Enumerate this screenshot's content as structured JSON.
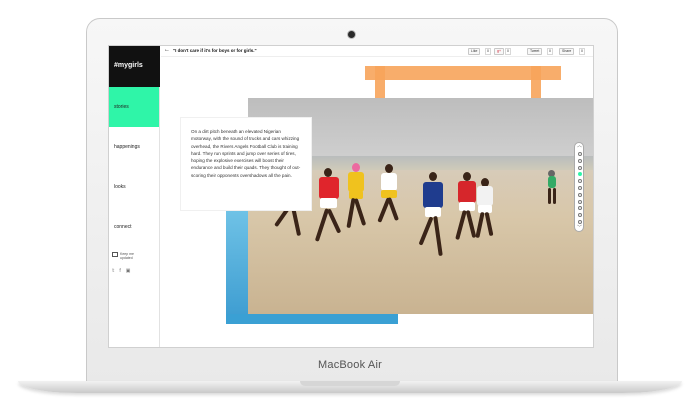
{
  "device": {
    "brand_label": "MacBook Air"
  },
  "logo": "#mygirls",
  "nav": [
    {
      "label": "stories",
      "active": true
    },
    {
      "label": "happenings",
      "active": false
    },
    {
      "label": "looks",
      "active": false
    },
    {
      "label": "connect",
      "active": false
    }
  ],
  "keep_up": {
    "line1": "Keep me",
    "line2": "updated"
  },
  "social_icons": [
    "twitter-icon",
    "facebook-icon",
    "instagram-icon"
  ],
  "topbar": {
    "headline": "\"I don't care if it's for boys or for girls.\"",
    "like_label": "Like",
    "like_count": "0",
    "share_gplus": "g+",
    "gplus_count": "0",
    "tweet_label": "Tweet",
    "tweet_count": "0",
    "share_label": "Share",
    "share_count": "0"
  },
  "caption": "On a dirt pitch beneath an elevated Nigerian motorway, with the sound of trucks and cars whizzing overhead, the Rivers Angels Football Club is training hard. They run sprints and jump over series of tires, hoping the explosive exercises will boost their endurance and build their quads. They thought of out-scoring their opponents overshadows all the pain.",
  "pager": {
    "total": 11,
    "active_index": 3
  },
  "colors": {
    "accent": "#2ff5a8",
    "orange": "#f7a45b",
    "blue": "#3aa0d4",
    "logo_bg": "#111111"
  }
}
